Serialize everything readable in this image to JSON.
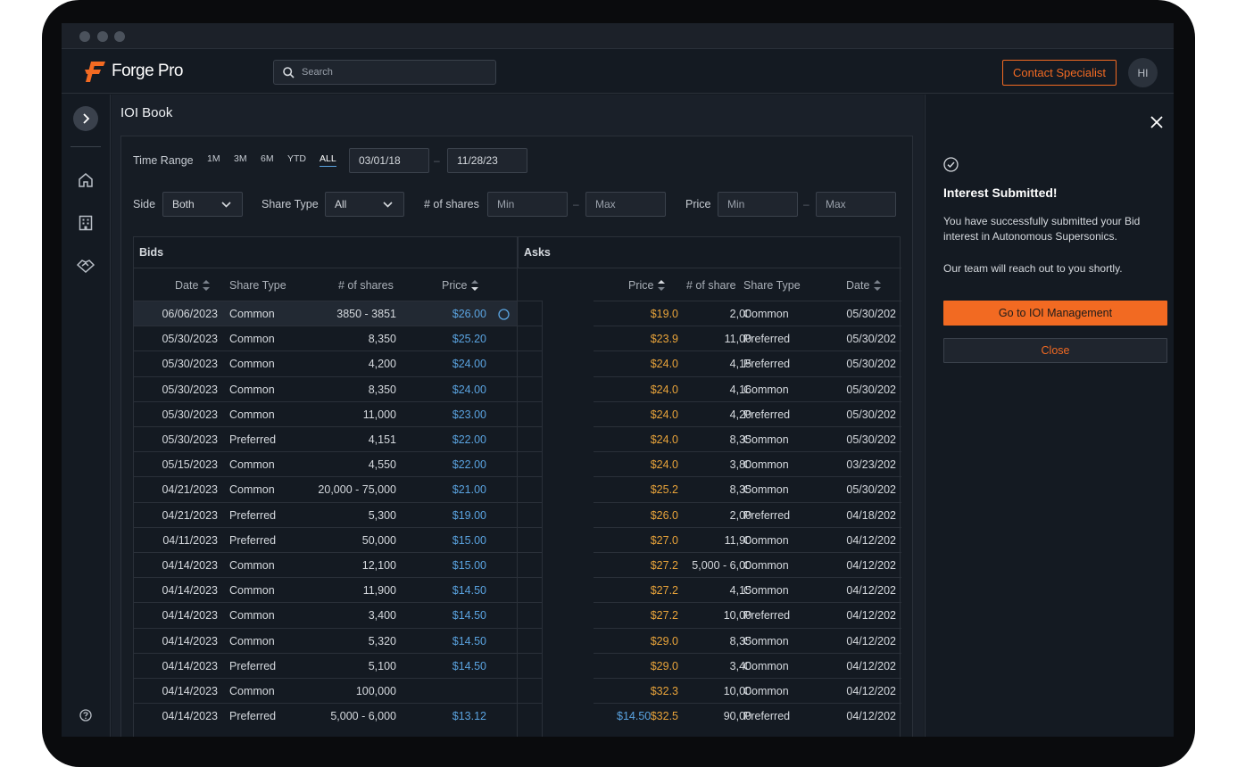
{
  "app": {
    "name": "Forge Pro"
  },
  "search": {
    "placeholder": "Search"
  },
  "header": {
    "contact_label": "Contact Specialist",
    "avatar_initials": "HI"
  },
  "page": {
    "title": "IOI Book"
  },
  "filters": {
    "time_range_label": "Time Range",
    "ranges": [
      "1M",
      "3M",
      "6M",
      "YTD",
      "ALL"
    ],
    "active_range": "ALL",
    "date_from": "03/01/18",
    "date_to": "11/28/23",
    "side_label": "Side",
    "side_value": "Both",
    "share_type_label": "Share Type",
    "share_type_value": "All",
    "shares_label": "# of shares",
    "shares_min": "Min",
    "shares_max": "Max",
    "price_label": "Price",
    "price_min": "Min",
    "price_max": "Max"
  },
  "bids": {
    "title": "Bids",
    "columns": [
      "Date",
      "Share Type",
      "# of shares",
      "Price"
    ],
    "rows": [
      {
        "date": "06/06/2023",
        "type": "Common",
        "shares": "3850 - 3851",
        "price": "$26.00"
      },
      {
        "date": "05/30/2023",
        "type": "Common",
        "shares": "8,350",
        "price": "$25.20"
      },
      {
        "date": "05/30/2023",
        "type": "Common",
        "shares": "4,200",
        "price": "$24.00"
      },
      {
        "date": "05/30/2023",
        "type": "Common",
        "shares": "8,350",
        "price": "$24.00"
      },
      {
        "date": "05/30/2023",
        "type": "Common",
        "shares": "11,000",
        "price": "$23.00"
      },
      {
        "date": "05/30/2023",
        "type": "Preferred",
        "shares": "4,151",
        "price": "$22.00"
      },
      {
        "date": "05/15/2023",
        "type": "Common",
        "shares": "4,550",
        "price": "$22.00"
      },
      {
        "date": "04/21/2023",
        "type": "Common",
        "shares": "20,000 - 75,000",
        "price": "$21.00"
      },
      {
        "date": "04/21/2023",
        "type": "Preferred",
        "shares": "5,300",
        "price": "$19.00"
      },
      {
        "date": "04/11/2023",
        "type": "Preferred",
        "shares": "50,000",
        "price": "$15.00"
      },
      {
        "date": "04/14/2023",
        "type": "Common",
        "shares": "12,100",
        "price": "$15.00"
      },
      {
        "date": "04/14/2023",
        "type": "Common",
        "shares": "11,900",
        "price": "$14.50"
      },
      {
        "date": "04/14/2023",
        "type": "Common",
        "shares": "3,400",
        "price": "$14.50"
      },
      {
        "date": "04/14/2023",
        "type": "Common",
        "shares": "5,320",
        "price": "$14.50"
      },
      {
        "date": "04/14/2023",
        "type": "Preferred",
        "shares": "5,100",
        "price": "$14.50"
      },
      {
        "date": "04/14/2023",
        "type": "Common",
        "shares": "100,000",
        "price": ""
      },
      {
        "date": "04/14/2023",
        "type": "Preferred",
        "shares": "5,000 - 6,000",
        "price": "$13.12"
      }
    ]
  },
  "asks": {
    "title": "Asks",
    "columns": [
      "Price",
      "# of share",
      "Share Type",
      "Date"
    ],
    "rows": [
      {
        "price": "$19.0",
        "shares": "2,00",
        "type": "Common",
        "date": "05/30/202"
      },
      {
        "price": "$23.9",
        "shares": "11,00",
        "type": "Preferred",
        "date": "05/30/202"
      },
      {
        "price": "$24.0",
        "shares": "4,15",
        "type": "Preferred",
        "date": "05/30/202"
      },
      {
        "price": "$24.0",
        "shares": "4,16",
        "type": "Common",
        "date": "05/30/202"
      },
      {
        "price": "$24.0",
        "shares": "4,20",
        "type": "Preferred",
        "date": "05/30/202"
      },
      {
        "price": "$24.0",
        "shares": "8,35",
        "type": "Common",
        "date": "05/30/202"
      },
      {
        "price": "$24.0",
        "shares": "3,80",
        "type": "Common",
        "date": "03/23/202"
      },
      {
        "price": "$25.2",
        "shares": "8,35",
        "type": "Common",
        "date": "05/30/202"
      },
      {
        "price": "$26.0",
        "shares": "2,00",
        "type": "Preferred",
        "date": "04/18/202"
      },
      {
        "price": "$27.0",
        "shares": "11,90",
        "type": "Common",
        "date": "04/12/202"
      },
      {
        "price": "$27.2",
        "shares": "5,000 - 6,00",
        "type": "Common",
        "date": "04/12/202"
      },
      {
        "price": "$27.2",
        "shares": "4,15",
        "type": "Common",
        "date": "04/12/202"
      },
      {
        "price": "$27.2",
        "shares": "10,00",
        "type": "Preferred",
        "date": "04/12/202"
      },
      {
        "price": "$29.0",
        "shares": "8,35",
        "type": "Common",
        "date": "04/12/202"
      },
      {
        "price": "$29.0",
        "shares": "3,40",
        "type": "Common",
        "date": "04/12/202"
      },
      {
        "price": "$32.3",
        "shares": "10,00",
        "type": "Common",
        "date": "04/12/202"
      },
      {
        "price": "$32.5",
        "shares": "90,00",
        "type": "Preferred",
        "date": "04/12/202",
        "overlap": "$14.50"
      }
    ]
  },
  "notification": {
    "title": "Interest Submitted!",
    "message": "You have successfully submitted your Bid interest in Autonomous Supersonics.",
    "followup": "Our team will reach out to you shortly.",
    "primary_label": "Go to IOI Management",
    "secondary_label": "Close"
  },
  "colors": {
    "accent": "#f26a22",
    "bid": "#5aa3e0",
    "ask": "#e8a33a",
    "bg": "#141a22"
  }
}
